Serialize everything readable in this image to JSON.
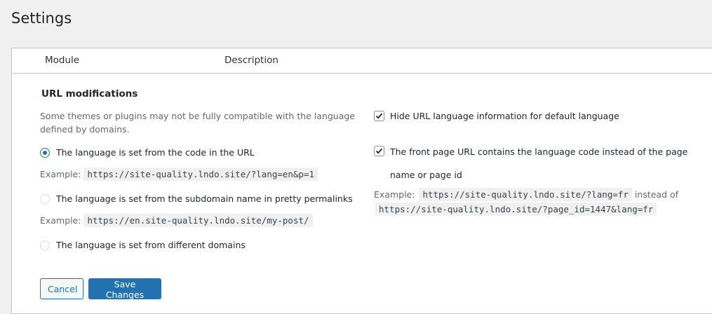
{
  "page": {
    "title": "Settings"
  },
  "table": {
    "columns": [
      "Module",
      "Description"
    ]
  },
  "section": {
    "title": "URL modifications",
    "note": "Some themes or plugins may not be fully compatible with the language defined by domains."
  },
  "options": [
    {
      "label": "The language is set from the code in the URL",
      "checked": true,
      "example_label": "Example:",
      "example_code": "https://site-quality.lndo.site/?lang=en&p=1"
    },
    {
      "label": "The language is set from the subdomain name in pretty permalinks",
      "checked": false,
      "example_label": "Example:",
      "example_code": "https://en.site-quality.lndo.site/my-post/"
    },
    {
      "label": "The language is set from different domains",
      "checked": false
    }
  ],
  "checkboxes": [
    {
      "label": "Hide URL language information for default language",
      "checked": true
    },
    {
      "label": "The front page URL contains the language code instead of the page name or page id",
      "checked": true
    }
  ],
  "front_example": {
    "label": "Example:",
    "code1": "https://site-quality.lndo.site/?lang=fr",
    "instead_of": "instead of",
    "code2": "https://site-quality.lndo.site/?page_id=1447&lang=fr"
  },
  "buttons": {
    "cancel": "Cancel",
    "save": "Save Changes"
  },
  "colors": {
    "accent": "#2271b1",
    "background": "#f0f0f1"
  }
}
